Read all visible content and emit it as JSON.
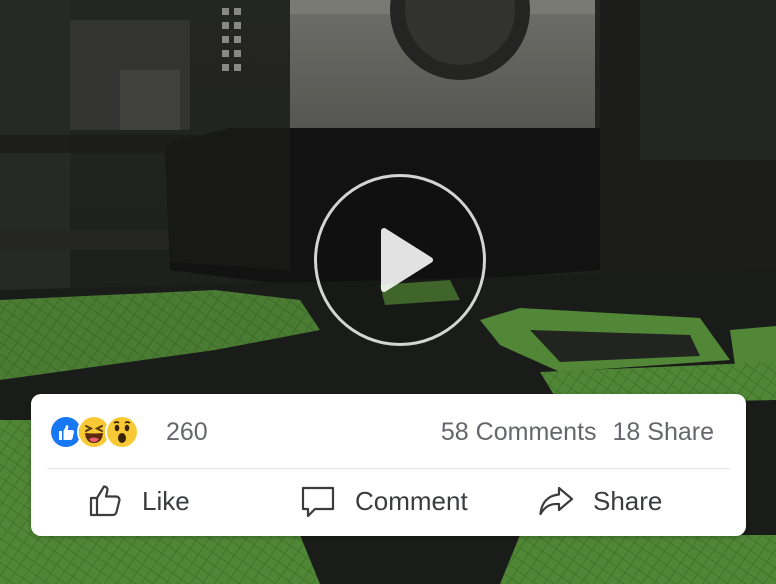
{
  "post": {
    "media": {
      "type": "video",
      "play_icon": "play-icon"
    },
    "reactions": {
      "icons": [
        "like-reaction-icon",
        "haha-reaction-icon",
        "wow-reaction-icon"
      ],
      "count": "260",
      "comments": "58 Comments",
      "shares": "18 Share"
    },
    "actions": {
      "like": {
        "label": "Like",
        "icon": "thumbs-up-icon"
      },
      "comment": {
        "label": "Comment",
        "icon": "comment-icon"
      },
      "share": {
        "label": "Share",
        "icon": "share-arrow-icon"
      }
    },
    "colors": {
      "like_blue": "#1877f2",
      "reaction_yellow": "#f7c934",
      "text_gray": "#65676b",
      "filament_green": "#5e9a3f"
    }
  }
}
